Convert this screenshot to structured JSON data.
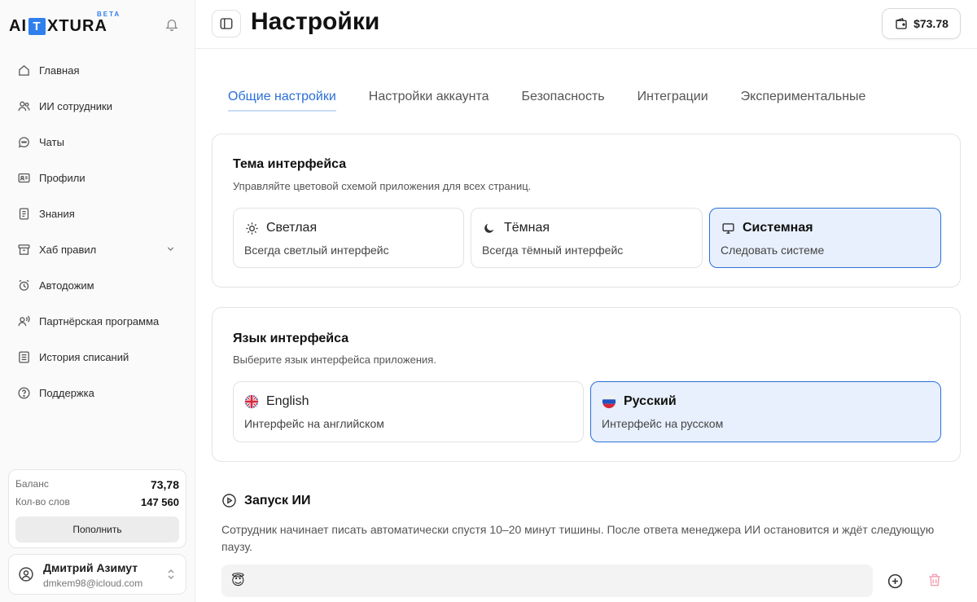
{
  "sidebar": {
    "logo": {
      "left": "AI",
      "box": "T",
      "right": "XTURA",
      "badge": "BETA"
    },
    "items": [
      {
        "label": "Главная",
        "icon": "home-icon"
      },
      {
        "label": "ИИ сотрудники",
        "icon": "users-icon"
      },
      {
        "label": "Чаты",
        "icon": "chat-icon"
      },
      {
        "label": "Профили",
        "icon": "id-card-icon"
      },
      {
        "label": "Знания",
        "icon": "book-icon"
      },
      {
        "label": "Хаб правил",
        "icon": "archive-icon"
      },
      {
        "label": "Автодожим",
        "icon": "alarm-clock-icon"
      },
      {
        "label": "Партнёрская программа",
        "icon": "user-signal-icon"
      },
      {
        "label": "История списаний",
        "icon": "list-icon"
      },
      {
        "label": "Поддержка",
        "icon": "question-icon"
      }
    ],
    "balance": {
      "balance_label": "Баланс",
      "balance_value": "73,78",
      "words_label": "Кол-во слов",
      "words_value": "147 560",
      "topup_label": "Пополнить"
    },
    "user": {
      "name": "Дмитрий Азимут",
      "email": "dmkem98@icloud.com"
    }
  },
  "header": {
    "title": "Настройки",
    "wallet": "$73.78"
  },
  "tabs": [
    {
      "label": "Общие настройки"
    },
    {
      "label": "Настройки аккаунта"
    },
    {
      "label": "Безопасность"
    },
    {
      "label": "Интеграции"
    },
    {
      "label": "Экспериментальные"
    }
  ],
  "theme": {
    "title": "Тема интерфейса",
    "desc": "Управляйте цветовой схемой приложения для всех страниц.",
    "options": [
      {
        "label": "Светлая",
        "desc": "Всегда светлый интерфейс",
        "icon": "sun-icon"
      },
      {
        "label": "Тёмная",
        "desc": "Всегда тёмный интерфейс",
        "icon": "moon-icon"
      },
      {
        "label": "Системная",
        "desc": "Следовать системе",
        "icon": "monitor-icon"
      }
    ]
  },
  "language": {
    "title": "Язык интерфейса",
    "desc": "Выберите язык интерфейса приложения.",
    "options": [
      {
        "label": "English",
        "desc": "Интерфейс на английском",
        "icon": "uk-flag-icon"
      },
      {
        "label": "Русский",
        "desc": "Интерфейс на русском",
        "icon": "ru-flag-icon"
      }
    ]
  },
  "launch": {
    "title": "Запуск ИИ",
    "desc": "Сотрудник начинает писать автоматически спустя 10–20 минут тишины. После ответа менеджера ИИ остановится и ждёт следующую паузу.",
    "emoji": "😇"
  },
  "colors": {
    "accent": "#2a6fd8",
    "selected_bg": "#e7f0fc",
    "logo_blue": "#2f80ed"
  }
}
